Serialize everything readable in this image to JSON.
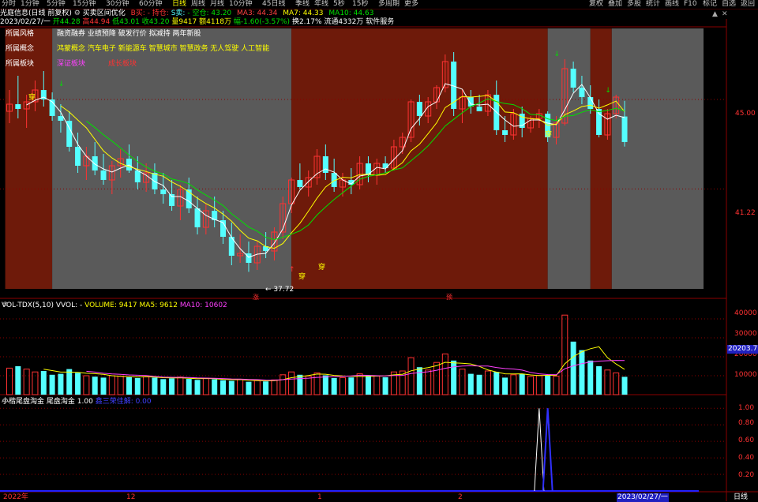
{
  "toolbar": {
    "timeframes": [
      "分时",
      "1分钟",
      "5分钟",
      "15分钟",
      "30分钟",
      "60分钟",
      "日线",
      "周线",
      "月线",
      "10分钟",
      "45日线",
      "季线",
      "年线",
      "5秒",
      "15秒",
      "多周期",
      "更多"
    ],
    "active_timeframe": "日线",
    "right_buttons": [
      "叠加",
      "多股",
      "统计",
      "画线",
      "F10",
      "标记",
      "自选",
      "返回"
    ],
    "left_button": "复权"
  },
  "header": {
    "title": "光庭信息(日线 前复权)",
    "indicator_name": "买卖区间优化",
    "b_label": "B买:",
    "hold_label": "- 持仓:",
    "s_label": "S卖:",
    "empty_label": "- 空仓:",
    "empty_value": "43.20",
    "ma3": "MA3: 44.34",
    "ma7": "MA7: 44.33",
    "ma10": "MA10: 44.63",
    "date": "2023/02/27/一",
    "open": "开44.28",
    "high": "高44.94",
    "low": "低43.01",
    "close": "收43.20",
    "volume": "量9417",
    "amount": "额4118万",
    "change": "幅-1.60(-3.57%)",
    "turnover": "换2.17%",
    "float_cap": "流通4332万",
    "industry": "软件服务"
  },
  "overlay": {
    "style_label": "所属风格",
    "style_value": "融资融券 业绩预降 破发行价 拟减持 两年新股",
    "concept_label": "所属概念",
    "concept_value": "鸿蒙概念 汽车电子 新能源车 智慧城市 智慧政务 无人驾驶 人工智能",
    "sector_label": "所属板块",
    "sector_value1": "深证板块",
    "sector_value2": "成长板块",
    "low_marker": "← 37.72",
    "chuan": "穿",
    "small_marker_1": "涨",
    "small_marker_2": "预"
  },
  "price_axis": {
    "p1": "45.00",
    "p2": "41.22"
  },
  "volume_panel": {
    "title": "VOL-TDX(5,10)",
    "vvol": "VVOL: -",
    "volume": "VOLUME: 9417",
    "ma5": "MA5: 9612",
    "ma10": "MA10: 10602",
    "axis": [
      "40000",
      "30000",
      "20000",
      "10000"
    ],
    "current_label": "20203.71"
  },
  "signal_panel": {
    "title": "小楷尾盘淘金",
    "name": "尾盘淘金",
    "value": "1.00",
    "sub": "鑫三荣佳解: 0.00",
    "axis": [
      "1.00",
      "0.80",
      "0.60",
      "0.40",
      "0.20"
    ]
  },
  "xaxis": {
    "labels": [
      "2022年",
      "12",
      "1",
      "2"
    ],
    "current_date": "2023/02/27/一",
    "period": "日线"
  },
  "colors": {
    "up": "#ff3232",
    "down": "#54ffff",
    "ma_white": "#ffffff",
    "ma_yellow": "#ffff00",
    "ma_green": "#00e000",
    "buy_band": "#6e1a0a",
    "sell_band": "#5a5a5a"
  },
  "chart_data": {
    "type": "candlestick",
    "candles": [
      [
        44.5,
        45.4,
        44.0,
        44.8
      ],
      [
        44.8,
        46.0,
        44.2,
        44.6
      ],
      [
        44.6,
        45.2,
        43.8,
        44.9
      ],
      [
        44.9,
        45.8,
        44.5,
        45.4
      ],
      [
        45.4,
        46.2,
        44.7,
        45.0
      ],
      [
        45.0,
        45.3,
        44.1,
        44.3
      ],
      [
        44.3,
        44.8,
        43.6,
        44.1
      ],
      [
        44.1,
        44.5,
        42.8,
        43.0
      ],
      [
        43.0,
        43.6,
        41.9,
        42.2
      ],
      [
        42.2,
        43.0,
        41.6,
        42.6
      ],
      [
        42.6,
        43.2,
        41.8,
        42.0
      ],
      [
        42.0,
        42.7,
        41.4,
        41.6
      ],
      [
        41.6,
        42.4,
        41.0,
        42.2
      ],
      [
        42.2,
        42.9,
        41.7,
        42.5
      ],
      [
        42.5,
        43.1,
        41.9,
        42.0
      ],
      [
        42.0,
        42.6,
        41.2,
        41.5
      ],
      [
        41.5,
        42.3,
        41.1,
        41.9
      ],
      [
        41.9,
        42.3,
        41.0,
        41.2
      ],
      [
        41.2,
        41.9,
        40.6,
        41.0
      ],
      [
        41.0,
        41.6,
        40.3,
        40.5
      ],
      [
        40.5,
        41.4,
        39.9,
        41.2
      ],
      [
        41.2,
        41.7,
        40.2,
        40.4
      ],
      [
        40.4,
        40.9,
        39.3,
        39.6
      ],
      [
        39.6,
        40.6,
        39.3,
        40.3
      ],
      [
        40.3,
        40.9,
        39.6,
        39.9
      ],
      [
        39.9,
        40.3,
        38.9,
        39.2
      ],
      [
        39.2,
        39.8,
        38.0,
        38.4
      ],
      [
        38.4,
        39.3,
        38.1,
        38.5
      ],
      [
        38.5,
        39.0,
        37.72,
        38.1
      ],
      [
        38.1,
        39.0,
        37.8,
        38.8
      ],
      [
        38.8,
        39.4,
        38.3,
        38.6
      ],
      [
        38.6,
        39.6,
        38.2,
        39.4
      ],
      [
        39.4,
        40.9,
        39.1,
        40.6
      ],
      [
        40.6,
        41.7,
        40.2,
        41.6
      ],
      [
        41.6,
        42.3,
        41.2,
        41.3
      ],
      [
        41.3,
        42.0,
        40.9,
        41.7
      ],
      [
        41.7,
        42.9,
        41.4,
        42.6
      ],
      [
        42.6,
        43.1,
        41.6,
        41.9
      ],
      [
        41.9,
        42.5,
        41.1,
        41.3
      ],
      [
        41.3,
        41.9,
        40.9,
        41.6
      ],
      [
        41.6,
        42.1,
        41.0,
        41.4
      ],
      [
        41.4,
        42.6,
        41.2,
        42.3
      ],
      [
        42.3,
        42.6,
        41.5,
        41.8
      ],
      [
        41.8,
        42.5,
        41.4,
        42.3
      ],
      [
        42.3,
        42.6,
        41.9,
        42.1
      ],
      [
        42.1,
        43.3,
        42.0,
        43.0
      ],
      [
        43.0,
        43.6,
        42.7,
        43.4
      ],
      [
        43.4,
        45.0,
        43.2,
        44.9
      ],
      [
        44.9,
        45.2,
        43.9,
        44.3
      ],
      [
        44.3,
        45.1,
        44.0,
        44.9
      ],
      [
        44.9,
        45.6,
        44.6,
        45.5
      ],
      [
        45.5,
        46.9,
        45.3,
        46.6
      ],
      [
        46.6,
        47.0,
        44.3,
        44.6
      ],
      [
        44.6,
        45.4,
        44.0,
        45.1
      ],
      [
        45.1,
        45.4,
        44.4,
        44.7
      ],
      [
        44.7,
        45.2,
        44.5,
        44.5
      ],
      [
        44.5,
        45.4,
        44.3,
        45.2
      ],
      [
        45.2,
        45.8,
        43.5,
        43.7
      ],
      [
        43.7,
        44.3,
        43.2,
        43.5
      ],
      [
        43.5,
        44.6,
        43.3,
        44.4
      ],
      [
        44.4,
        44.7,
        43.4,
        43.8
      ],
      [
        43.8,
        44.3,
        43.6,
        44.2
      ],
      [
        44.2,
        44.6,
        43.8,
        44.4
      ],
      [
        44.4,
        44.5,
        43.2,
        43.4
      ],
      [
        43.4,
        44.3,
        43.1,
        44.0
      ],
      [
        44.0,
        46.7,
        43.9,
        46.3
      ],
      [
        46.3,
        46.6,
        45.3,
        45.5
      ],
      [
        45.5,
        46.0,
        44.8,
        45.1
      ],
      [
        45.1,
        45.6,
        44.4,
        44.6
      ],
      [
        44.6,
        45.0,
        43.4,
        43.5
      ],
      [
        43.5,
        44.6,
        43.3,
        44.4
      ],
      [
        44.4,
        45.2,
        44.2,
        45.1
      ],
      [
        44.28,
        44.94,
        43.01,
        43.2
      ]
    ],
    "volumes": [
      14000,
      15000,
      13500,
      12000,
      12500,
      10500,
      11000,
      13500,
      11500,
      10000,
      9500,
      9000,
      10000,
      9800,
      9200,
      8800,
      9500,
      9000,
      8200,
      8600,
      9300,
      8300,
      7800,
      8700,
      8100,
      7600,
      7300,
      8100,
      6800,
      7400,
      7000,
      7800,
      10500,
      12000,
      10500,
      9800,
      11500,
      10200,
      8800,
      9000,
      9100,
      11000,
      10200,
      9800,
      9200,
      12000,
      12500,
      19500,
      14500,
      13000,
      17000,
      21500,
      18000,
      13500,
      11000,
      10500,
      12500,
      12000,
      9000,
      10500,
      11000,
      9600,
      10200,
      10000,
      9800,
      42000,
      28000,
      23500,
      18000,
      15000,
      13000,
      11500,
      9417
    ],
    "volume_up": [
      true,
      false,
      true,
      true,
      false,
      false,
      false,
      false,
      false,
      true,
      false,
      false,
      true,
      true,
      false,
      false,
      true,
      false,
      false,
      false,
      true,
      false,
      false,
      true,
      false,
      false,
      false,
      true,
      false,
      true,
      false,
      true,
      true,
      true,
      false,
      true,
      true,
      false,
      false,
      true,
      false,
      true,
      false,
      true,
      false,
      true,
      true,
      true,
      false,
      true,
      true,
      true,
      false,
      true,
      false,
      false,
      true,
      false,
      false,
      true,
      false,
      true,
      true,
      false,
      true,
      true,
      false,
      false,
      false,
      false,
      true,
      true,
      false
    ],
    "ylim": [
      37.0,
      48.0
    ],
    "vol_ylim": [
      0,
      45000
    ]
  }
}
